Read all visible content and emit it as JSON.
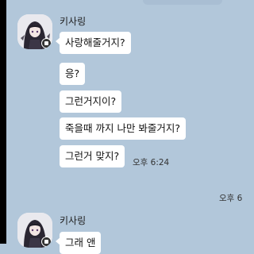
{
  "chat": {
    "groups": [
      {
        "sender": "키사링",
        "messages": [
          "사랑해줄거지?",
          "응?",
          "그런거지이?",
          "죽을때 까지 나만 봐줄거지?",
          "그런거 맞지?"
        ],
        "time": "오후 6:24"
      },
      {
        "sender": "키사링",
        "messages": [
          "그래 앤"
        ]
      }
    ],
    "right_time": "오후 6"
  },
  "icons": {
    "avatar": "anime-girl-avatar",
    "badge": "profile-badge-icon"
  },
  "colors": {
    "background": "#b2c7da",
    "bubble": "#ffffff",
    "left_edge": "#000000"
  }
}
